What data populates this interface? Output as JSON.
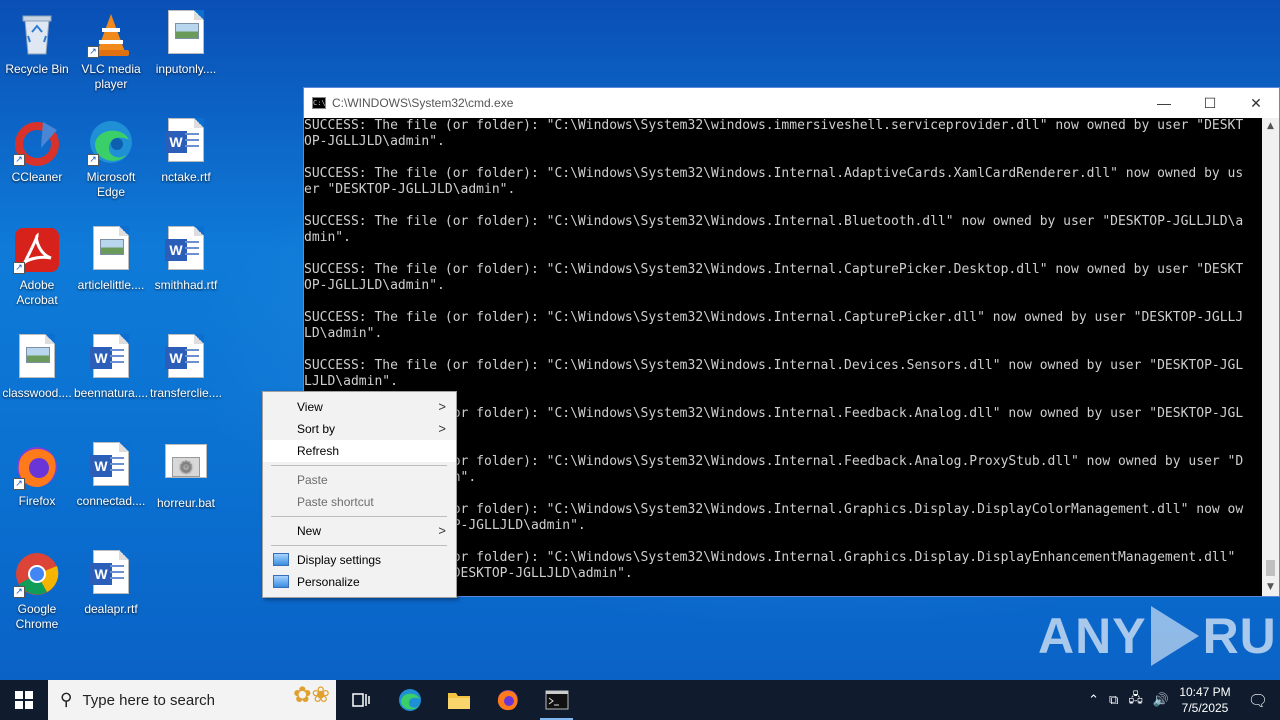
{
  "desktop": {
    "icons": [
      {
        "label": "Recycle Bin",
        "icon": "recycle-bin-icon"
      },
      {
        "label": "VLC media player",
        "icon": "vlc-icon"
      },
      {
        "label": "inputonly....",
        "icon": "image-file-icon"
      },
      {
        "label": "CCleaner",
        "icon": "ccleaner-icon"
      },
      {
        "label": "Microsoft Edge",
        "icon": "edge-icon"
      },
      {
        "label": "nctake.rtf",
        "icon": "word-document-icon"
      },
      {
        "label": "Adobe Acrobat",
        "icon": "acrobat-icon"
      },
      {
        "label": "articlelittle....",
        "icon": "image-file-icon"
      },
      {
        "label": "smithhad.rtf",
        "icon": "word-document-icon"
      },
      {
        "label": "classwood....",
        "icon": "image-file-icon"
      },
      {
        "label": "beennatura....",
        "icon": "word-document-icon"
      },
      {
        "label": "transferclie....",
        "icon": "word-document-icon"
      },
      {
        "label": "Firefox",
        "icon": "firefox-icon"
      },
      {
        "label": "connectad....",
        "icon": "word-document-icon"
      },
      {
        "label": "horreur.bat",
        "icon": "batch-file-icon"
      },
      {
        "label": "Google Chrome",
        "icon": "chrome-icon"
      },
      {
        "label": "dealapr.rtf",
        "icon": "word-document-icon"
      }
    ]
  },
  "cmd": {
    "title": "C:\\WINDOWS\\System32\\cmd.exe",
    "minimize": "—",
    "maximize": "☐",
    "close": "✕",
    "output": "SUCCESS: The file (or folder): \"C:\\Windows\\System32\\windows.immersiveshell.serviceprovider.dll\" now owned by user \"DESKT\nOP-JGLLJLD\\admin\".\n\nSUCCESS: The file (or folder): \"C:\\Windows\\System32\\Windows.Internal.AdaptiveCards.XamlCardRenderer.dll\" now owned by us\ner \"DESKTOP-JGLLJLD\\admin\".\n\nSUCCESS: The file (or folder): \"C:\\Windows\\System32\\Windows.Internal.Bluetooth.dll\" now owned by user \"DESKTOP-JGLLJLD\\a\ndmin\".\n\nSUCCESS: The file (or folder): \"C:\\Windows\\System32\\Windows.Internal.CapturePicker.Desktop.dll\" now owned by user \"DESKT\nOP-JGLLJLD\\admin\".\n\nSUCCESS: The file (or folder): \"C:\\Windows\\System32\\Windows.Internal.CapturePicker.dll\" now owned by user \"DESKTOP-JGLLJ\nLD\\admin\".\n\nSUCCESS: The file (or folder): \"C:\\Windows\\System32\\Windows.Internal.Devices.Sensors.dll\" now owned by user \"DESKTOP-JGL\nLJLD\\admin\".\n\nSUCCESS: The file (or folder): \"C:\\Windows\\System32\\Windows.Internal.Feedback.Analog.dll\" now owned by user \"DESKTOP-JGL\nLJLD\\admin\".\n\nSUCCESS: The file (or folder): \"C:\\Windows\\System32\\Windows.Internal.Feedback.Analog.ProxyStub.dll\" now owned by user \"D\nESKTOP-JGLLJLD\\admin\".\n\nSUCCESS: The file (or folder): \"C:\\Windows\\System32\\Windows.Internal.Graphics.Display.DisplayColorManagement.dll\" now ow\nned by user \"DESKTOP-JGLLJLD\\admin\".\n\nSUCCESS: The file (or folder): \"C:\\Windows\\System32\\Windows.Internal.Graphics.Display.DisplayEnhancementManagement.dll\"\nnow owned by user \"DESKTOP-JGLLJLD\\admin\"."
  },
  "context_menu": {
    "view": "View",
    "sort_by": "Sort by",
    "refresh": "Refresh",
    "paste": "Paste",
    "paste_shortcut": "Paste shortcut",
    "new": "New",
    "display_settings": "Display settings",
    "personalize": "Personalize"
  },
  "watermark": {
    "left": "ANY",
    "right": "RUN"
  },
  "taskbar": {
    "search_placeholder": "Type here to search",
    "time": "10:47 PM",
    "date": "7/5/2025"
  }
}
